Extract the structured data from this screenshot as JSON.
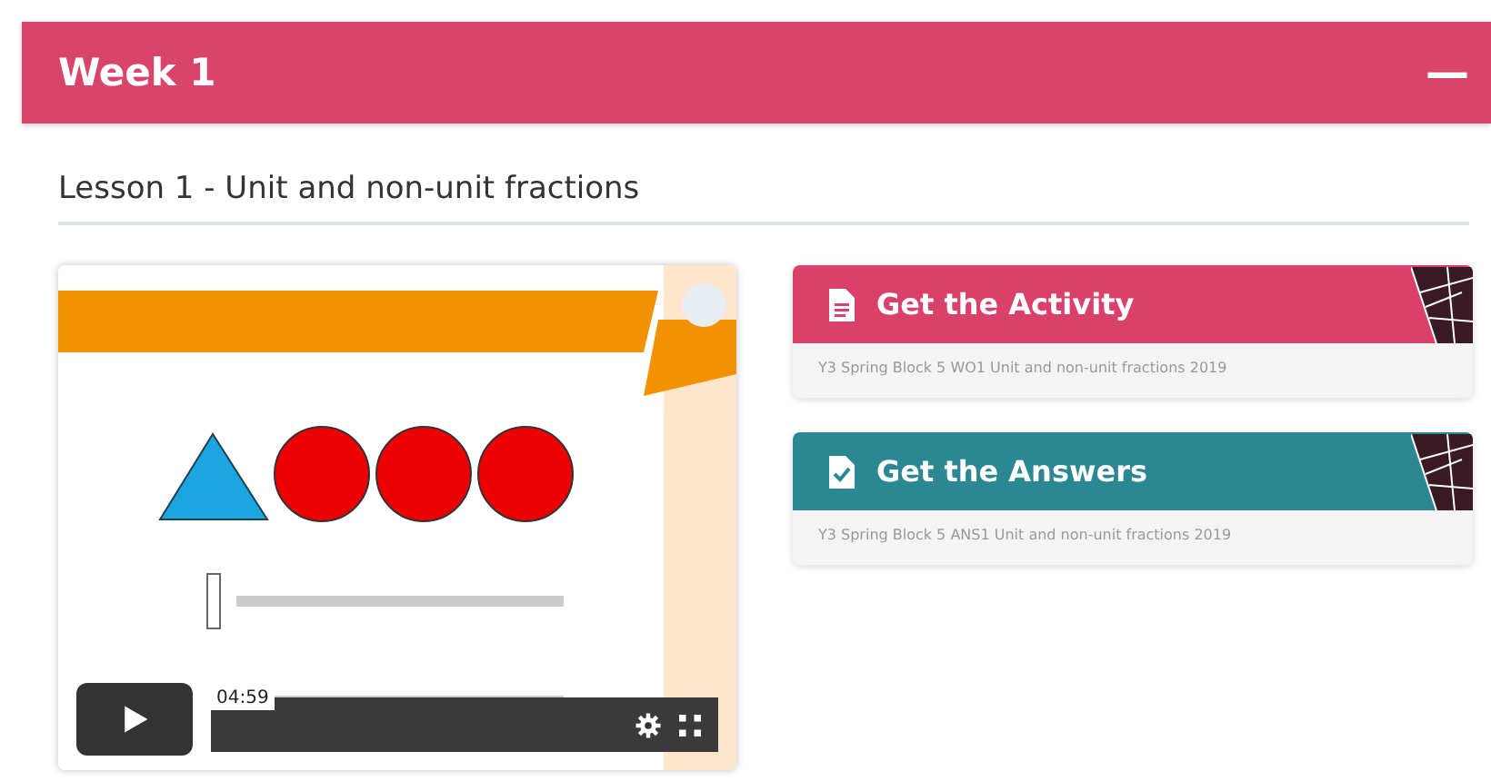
{
  "section": {
    "title": "Week 1",
    "toggle": "—",
    "expanded": true
  },
  "lesson": {
    "title": "Lesson 1 - Unit and non-unit fractions"
  },
  "video": {
    "kind": "picture",
    "time": "04:59"
  },
  "resources": [
    {
      "kind": "activity",
      "title": "Get the Activity",
      "file": "Y3 Spring Block 5 WO1 Unit and non-unit fractions 2019",
      "color": "#d9416a"
    },
    {
      "kind": "answers",
      "title": "Get the Answers",
      "file": "Y3 Spring Block 5 ANS1 Unit and non-unit fractions 2019",
      "color": "#2b8892"
    }
  ]
}
